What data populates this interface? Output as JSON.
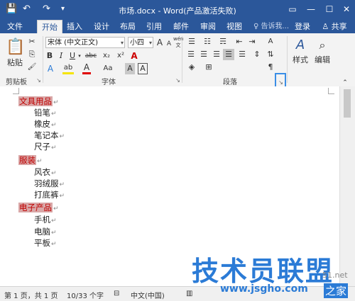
{
  "titlebar": {
    "title": "市场.docx - Word(产品激活失败)",
    "save_icon": "💾",
    "undo_icon": "↶",
    "redo_icon": "↷",
    "qa_more_icon": "▾",
    "ribbon_display_icon": "▭",
    "minimize_icon": "—",
    "maximize_icon": "☐",
    "close_icon": "✕"
  },
  "tabs": [
    {
      "label": "文件"
    },
    {
      "label": "开始"
    },
    {
      "label": "插入"
    },
    {
      "label": "设计"
    },
    {
      "label": "布局"
    },
    {
      "label": "引用"
    },
    {
      "label": "邮件"
    },
    {
      "label": "审阅"
    },
    {
      "label": "视图"
    }
  ],
  "tell_me": "♀ 告诉我...",
  "login": "登录",
  "share": "♙ 共享",
  "clipboard": {
    "paste_label": "粘贴",
    "group_label": "剪贴板",
    "cut": "✂",
    "copy": "⎘",
    "format_painter": "🖌"
  },
  "font": {
    "font_name": "宋体 (中文正文)",
    "font_size": "小四",
    "group_label": "字体",
    "grow": "A",
    "shrink": "A",
    "clear": "A",
    "wen": "wén",
    "bold": "B",
    "italic": "I",
    "underline": "U",
    "strike": "abc",
    "sub": "x₂",
    "sup": "x²",
    "text_effects": "A",
    "highlight": "ab",
    "font_color": "A",
    "case": "Aa",
    "char_shading": "A",
    "char_border": "A"
  },
  "paragraph": {
    "group_label": "段落",
    "launcher": "↘",
    "bullets": "☰",
    "numbering": "☷",
    "multilevel": "☴",
    "indent_dec": "⇤",
    "indent_inc": "⇥",
    "asian": "A",
    "sort": "⇅",
    "show_marks": "¶",
    "align_left": "☰",
    "center": "☰",
    "align_right": "☰",
    "justify": "☰",
    "distributed": "☰",
    "line_spacing": "⇕",
    "shading": "◈",
    "borders": "⊞"
  },
  "styles": {
    "label": "样式",
    "icon": "A"
  },
  "editing": {
    "label": "编辑",
    "icon": "⌕"
  },
  "document": {
    "lines": [
      {
        "text": "文具用品",
        "heading": true
      },
      {
        "text": "铅笔",
        "heading": false
      },
      {
        "text": "橡皮",
        "heading": false
      },
      {
        "text": "笔记本",
        "heading": false
      },
      {
        "text": "尺子",
        "heading": false
      },
      {
        "text": "服装",
        "heading": true
      },
      {
        "text": "风衣",
        "heading": false
      },
      {
        "text": "羽绒服",
        "heading": false
      },
      {
        "text": "打底裤",
        "heading": false
      },
      {
        "text": "电子产品",
        "heading": true
      },
      {
        "text": "手机",
        "heading": false
      },
      {
        "text": "电脑",
        "heading": false
      },
      {
        "text": "平板",
        "heading": false
      }
    ],
    "para_mark": "↵"
  },
  "status": {
    "page": "第 1 页，共 1 页",
    "words": "10/33 个字",
    "macro": "⊟",
    "lang": "中文(中国)",
    "view": "▥"
  },
  "watermark": {
    "main": "技术员联盟",
    "sub": "www.jsgho.com",
    "site_a": "51.net",
    "site_b": "之家"
  },
  "colors": {
    "accent": "#2b579a",
    "heading_text": "#c00000",
    "heading_bg": "#d9a8a8"
  }
}
